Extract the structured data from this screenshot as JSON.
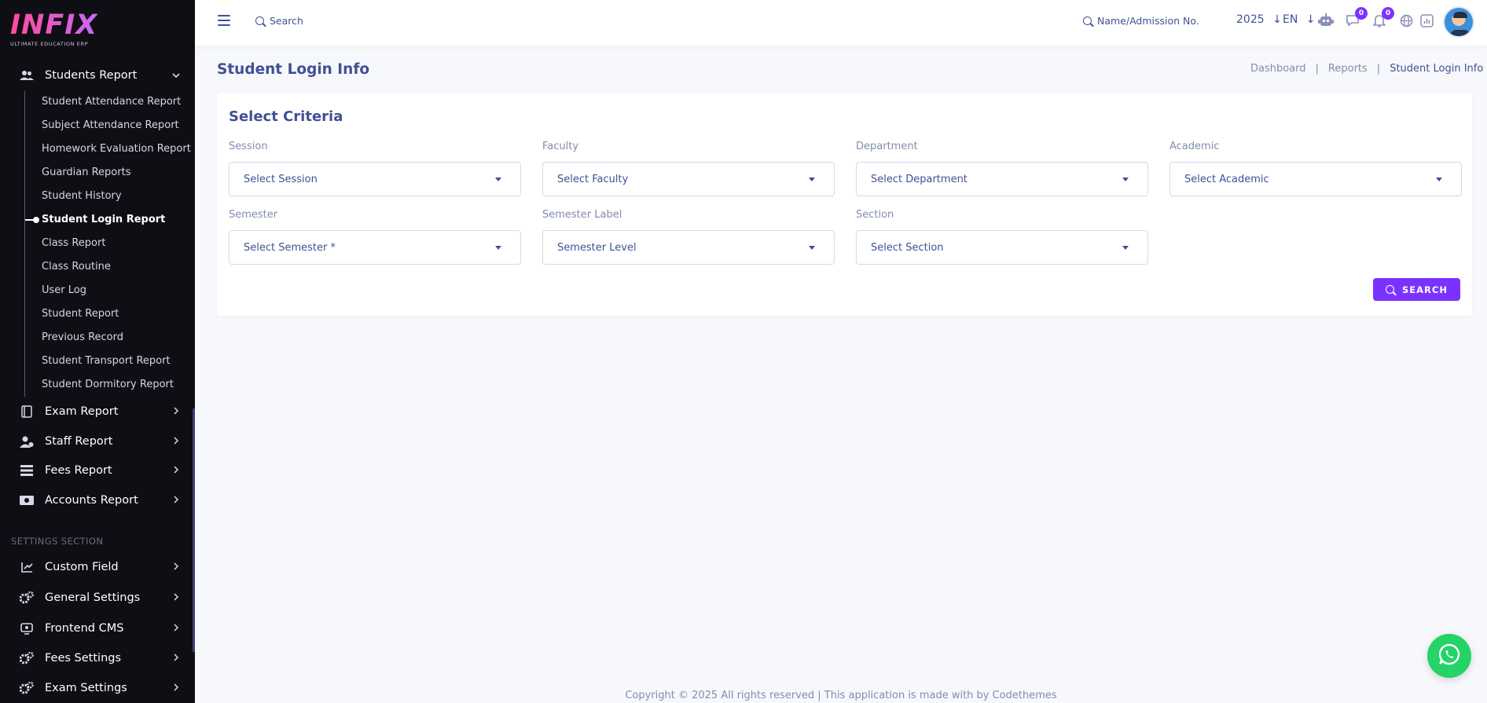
{
  "brand": {
    "logo_text": "INFIX",
    "tagline": "ULTIMATE EDUCATION ERP"
  },
  "sidebar": {
    "students_report": {
      "label": "Students Report",
      "icon": "users-icon",
      "items": [
        {
          "label": "Student Attendance Report"
        },
        {
          "label": "Subject Attendance Report"
        },
        {
          "label": "Homework Evaluation Report"
        },
        {
          "label": "Guardian Reports"
        },
        {
          "label": "Student History"
        },
        {
          "label": "Student Login Report",
          "active": true
        },
        {
          "label": "Class Report"
        },
        {
          "label": "Class Routine"
        },
        {
          "label": "User Log"
        },
        {
          "label": "Student Report"
        },
        {
          "label": "Previous Record"
        },
        {
          "label": "Student Transport Report"
        },
        {
          "label": "Student Dormitory Report"
        }
      ]
    },
    "menus": [
      {
        "label": "Exam Report",
        "icon": "book-icon"
      },
      {
        "label": "Staff Report",
        "icon": "staff-icon"
      },
      {
        "label": "Fees Report",
        "icon": "list-icon"
      },
      {
        "label": "Accounts Report",
        "icon": "money-icon"
      }
    ],
    "settings_section_label": "SETTINGS SECTION",
    "settings_menus": [
      {
        "label": "Custom Field",
        "icon": "field-icon"
      },
      {
        "label": "General Settings",
        "icon": "gears-icon"
      },
      {
        "label": "Frontend CMS",
        "icon": "monitor-icon"
      },
      {
        "label": "Fees Settings",
        "icon": "gears-icon"
      },
      {
        "label": "Exam Settings",
        "icon": "gears-icon"
      }
    ]
  },
  "header": {
    "search_label": "Search",
    "admission_search_label": "Name/Admission No.",
    "year": "2025",
    "language": "EN",
    "chat_badge": "0",
    "notification_badge": "0"
  },
  "page": {
    "title": "Student Login Info",
    "breadcrumb": [
      "Dashboard",
      "Reports",
      "Student Login Info"
    ]
  },
  "criteria": {
    "title": "Select Criteria",
    "fields": [
      {
        "label": "Session",
        "placeholder": "Select Session"
      },
      {
        "label": "Faculty",
        "placeholder": "Select Faculty"
      },
      {
        "label": "Department",
        "placeholder": "Select Department"
      },
      {
        "label": "Academic",
        "placeholder": "Select Academic"
      },
      {
        "label": "Semester",
        "placeholder": "Select Semester *"
      },
      {
        "label": "Semester Label",
        "placeholder": "Semester Level"
      },
      {
        "label": "Section",
        "placeholder": "Select Section"
      }
    ],
    "search_button": "SEARCH"
  },
  "footer": {
    "text": "Copyright © 2025 All rights reserved | This application is made with by Codethemes"
  },
  "colors": {
    "accent": "#7c32ff",
    "text": "#415094",
    "sidebar_bg": "#0e0e14",
    "whatsapp": "#25d366"
  }
}
